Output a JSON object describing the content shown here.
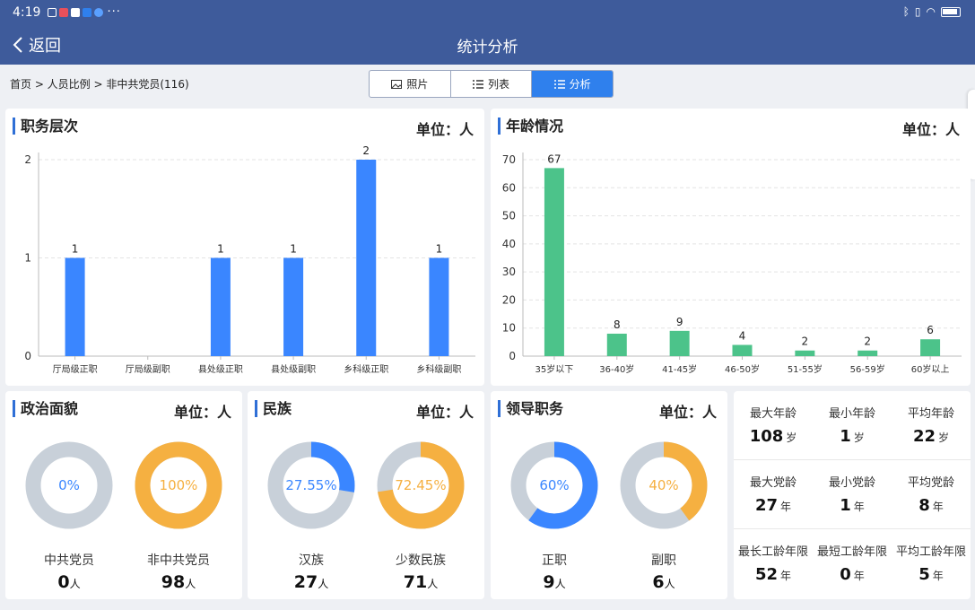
{
  "status": {
    "time": "4:19",
    "dots": "···"
  },
  "nav": {
    "back_label": "返回",
    "title": "统计分析"
  },
  "breadcrumb": "首页 > 人员比例 > 非中共党员(116)",
  "tabs": [
    {
      "label": "照片",
      "icon": "image-icon"
    },
    {
      "label": "列表",
      "icon": "list-icon"
    },
    {
      "label": "分析",
      "icon": "list-icon"
    }
  ],
  "colors": {
    "blue": "#3a86ff",
    "green": "#4cc38a",
    "orange": "#f5b041",
    "gray": "#c8d0d9",
    "ring_blue": "#3a8ee8"
  },
  "duty": {
    "title": "职务层次",
    "unit": "单位：人",
    "chart_data": {
      "type": "bar",
      "categories": [
        "厅局级正职",
        "厅局级副职",
        "县处级正职",
        "县处级副职",
        "乡科级正职",
        "乡科级副职"
      ],
      "values": [
        1,
        0,
        1,
        1,
        2,
        1
      ],
      "value_labels": [
        "1",
        "",
        "1",
        "1",
        "2",
        "1"
      ],
      "ylim": [
        0,
        2
      ],
      "yticks": [
        0,
        1,
        2
      ]
    }
  },
  "age": {
    "title": "年龄情况",
    "unit": "单位：人",
    "chart_data": {
      "type": "bar",
      "categories": [
        "35岁以下",
        "36-40岁",
        "41-45岁",
        "46-50岁",
        "51-55岁",
        "56-59岁",
        "60岁以上"
      ],
      "values": [
        67,
        8,
        9,
        4,
        2,
        2,
        6
      ],
      "ylim": [
        0,
        70
      ],
      "yticks": [
        0,
        10,
        20,
        30,
        40,
        50,
        60,
        70
      ]
    }
  },
  "political": {
    "title": "政治面貌",
    "unit": "单位：人",
    "items": [
      {
        "pct": "0%",
        "fraction": 0,
        "label": "中共党员",
        "value": "0",
        "suffix": "人",
        "color": "blue"
      },
      {
        "pct": "100%",
        "fraction": 1,
        "label": "非中共党员",
        "value": "98",
        "suffix": "人",
        "color": "orange"
      }
    ]
  },
  "ethnic": {
    "title": "民族",
    "unit": "单位：人",
    "items": [
      {
        "pct": "27.55%",
        "fraction": 0.2755,
        "label": "汉族",
        "value": "27",
        "suffix": "人",
        "color": "blue"
      },
      {
        "pct": "72.45%",
        "fraction": 0.7245,
        "label": "少数民族",
        "value": "71",
        "suffix": "人",
        "color": "orange"
      }
    ]
  },
  "leader": {
    "title": "领导职务",
    "unit": "单位：人",
    "items": [
      {
        "pct": "60%",
        "fraction": 0.6,
        "label": "正职",
        "value": "9",
        "suffix": "人",
        "color": "blue"
      },
      {
        "pct": "40%",
        "fraction": 0.4,
        "label": "副职",
        "value": "6",
        "suffix": "人",
        "color": "orange"
      }
    ]
  },
  "stats": [
    [
      {
        "label": "最大年龄",
        "value": "108",
        "unit": "岁"
      },
      {
        "label": "最小年龄",
        "value": "1",
        "unit": "岁"
      },
      {
        "label": "平均年龄",
        "value": "22",
        "unit": "岁"
      }
    ],
    [
      {
        "label": "最大党龄",
        "value": "27",
        "unit": "年"
      },
      {
        "label": "最小党龄",
        "value": "1",
        "unit": "年"
      },
      {
        "label": "平均党龄",
        "value": "8",
        "unit": "年"
      }
    ],
    [
      {
        "label": "最长工龄年限",
        "value": "52",
        "unit": "年"
      },
      {
        "label": "最短工龄年限",
        "value": "0",
        "unit": "年"
      },
      {
        "label": "平均工龄年限",
        "value": "5",
        "unit": "年"
      }
    ]
  ]
}
